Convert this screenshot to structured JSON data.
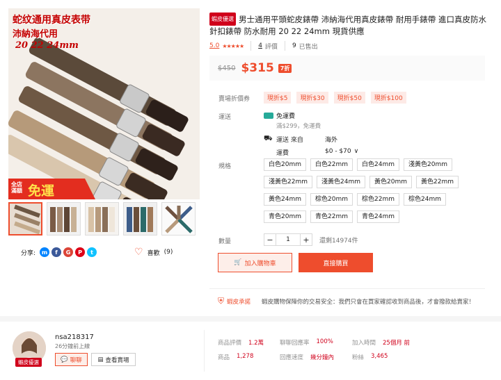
{
  "gallery": {
    "overlay_text_1": "蛇纹通用真皮表带",
    "overlay_text_2": "沛納海代用",
    "overlay_sizes": "20 22 24mm",
    "promo_line1": "全店",
    "promo_line2": "滿額",
    "promo_big": "免運",
    "thumb_count": 5
  },
  "share": {
    "label": "分享:",
    "icons": [
      "messenger-icon",
      "facebook-icon",
      "google-plus-icon",
      "pinterest-icon",
      "twitter-icon"
    ]
  },
  "like": {
    "label": "喜歡",
    "count": "(9)"
  },
  "product": {
    "badge": "蝦皮優選",
    "title": "男士通用平頭蛇皮錶帶 沛納海代用真皮錶帶 耐用手錶帶 進口真皮防水針扣錶帶 防水耐用 20 22 24mm 現貨供應",
    "rating": "5.0",
    "stars": "★★★★★",
    "reviews_num": "4",
    "reviews_label": "評價",
    "sold_num": "9",
    "sold_label": "已售出",
    "old_price": "$450",
    "price": "$315",
    "discount": "7折"
  },
  "labels": {
    "voucher": "賣場折價券",
    "shipping": "運送",
    "spec": "規格",
    "quantity": "數量"
  },
  "vouchers": [
    "現折$5",
    "現折$30",
    "現折$50",
    "現折$100"
  ],
  "shipping": {
    "free_title": "免運費",
    "free_desc": "滿$299，免運費",
    "from_label": "運送 來自",
    "from_value": "海外",
    "fee_label": "運費",
    "fee_value": "$0 - $70",
    "chevron": "∨"
  },
  "options": [
    "白色20mm",
    "白色22mm",
    "白色24mm",
    "淺黃色20mm",
    "淺黃色22mm",
    "淺黃色24mm",
    "黃色20mm",
    "黃色22mm",
    "黃色24mm",
    "棕色20mm",
    "棕色22mm",
    "棕色24mm",
    "青色20mm",
    "青色22mm",
    "青色24mm"
  ],
  "quantity": {
    "minus": "−",
    "value": "1",
    "plus": "+",
    "stock": "還剩14974件"
  },
  "buttons": {
    "cart": "加入購物車",
    "buy": "直接購買"
  },
  "guarantee": {
    "title": "蝦皮承諾",
    "text": "蝦皮購物保障你的交易安全：我們只會在買家確認收到商品後，才會撥款給賣家！"
  },
  "shop": {
    "name": "nsa218317",
    "online": "26分鐘前上線",
    "badge": "蝦皮優選",
    "chat": "聊聊",
    "view_shop": "查看賣場",
    "stats": [
      {
        "k": "商品評價",
        "v": "1.2萬"
      },
      {
        "k": "聊聊回應率",
        "v": "100%"
      },
      {
        "k": "加入時間",
        "v": "25個月 前"
      },
      {
        "k": "商品",
        "v": "1,278"
      },
      {
        "k": "回應速度",
        "v": "幾分鐘內"
      },
      {
        "k": "粉絲",
        "v": "3,465"
      }
    ]
  },
  "colors": {
    "accent": "#ee4d2d",
    "badge": "#d0011b",
    "free_ship": "#26aa99"
  }
}
